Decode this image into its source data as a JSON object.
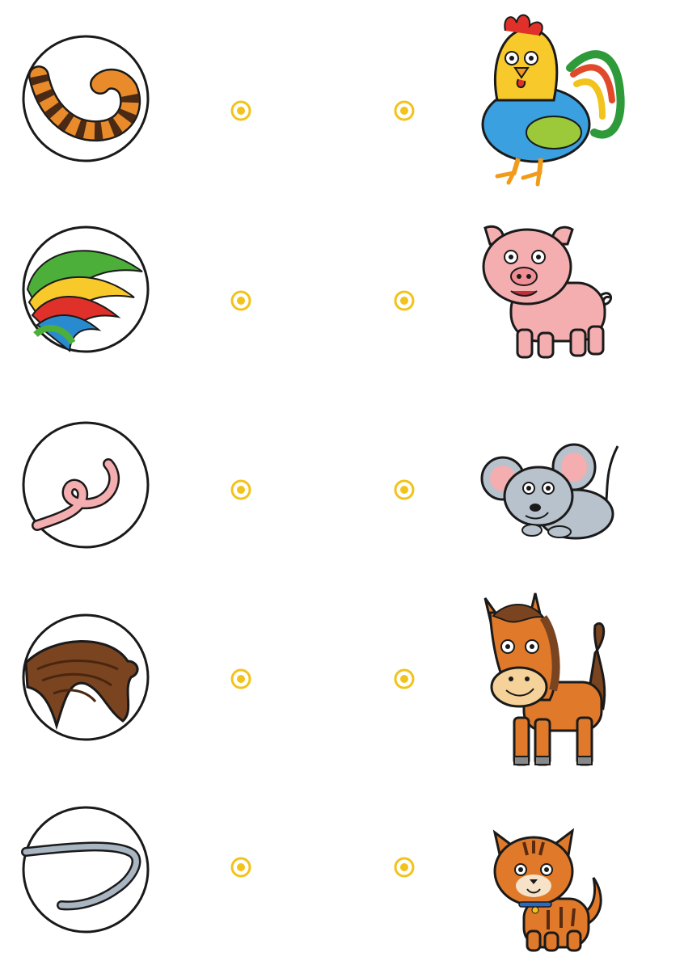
{
  "worksheet": {
    "rows": [
      {
        "tail_icon": "tiger-striped-tail-icon",
        "animal_icon": "rooster-icon"
      },
      {
        "tail_icon": "rooster-feather-tail-icon",
        "animal_icon": "pig-icon"
      },
      {
        "tail_icon": "pig-curly-tail-icon",
        "animal_icon": "mouse-icon"
      },
      {
        "tail_icon": "horse-hair-tail-icon",
        "animal_icon": "horse-icon"
      },
      {
        "tail_icon": "mouse-thin-tail-icon",
        "animal_icon": "cat-icon"
      }
    ],
    "colors": {
      "dot": "#F2C31B",
      "outline": "#1a1a1a",
      "background": "#ffffff"
    }
  }
}
